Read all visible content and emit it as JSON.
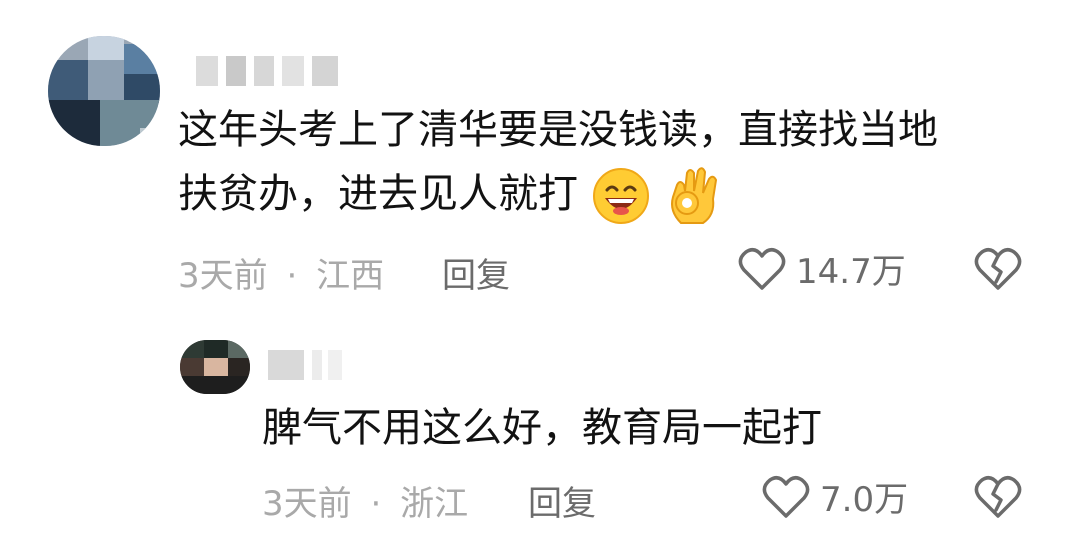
{
  "comments": [
    {
      "text_line1": "这年头考上了清华要是没钱读，直接找当地",
      "text_line2": "扶贫办，进去见人就打",
      "emojis": [
        "grinning-face-emoji",
        "ok-hand-emoji"
      ],
      "time": "3天前",
      "separator": "·",
      "location": "江西",
      "reply_label": "回复",
      "likes": "14.7万"
    },
    {
      "text": "脾气不用这么好，教育局一起打",
      "time": "3天前",
      "separator": "·",
      "location": "浙江",
      "reply_label": "回复",
      "likes": "7.0万"
    }
  ],
  "icons": {
    "like": "heart-outline-icon",
    "dislike": "broken-heart-icon"
  },
  "colors": {
    "meta_gray": "#a9a9a9",
    "action_gray": "#6b6b6b",
    "text": "#121212"
  }
}
